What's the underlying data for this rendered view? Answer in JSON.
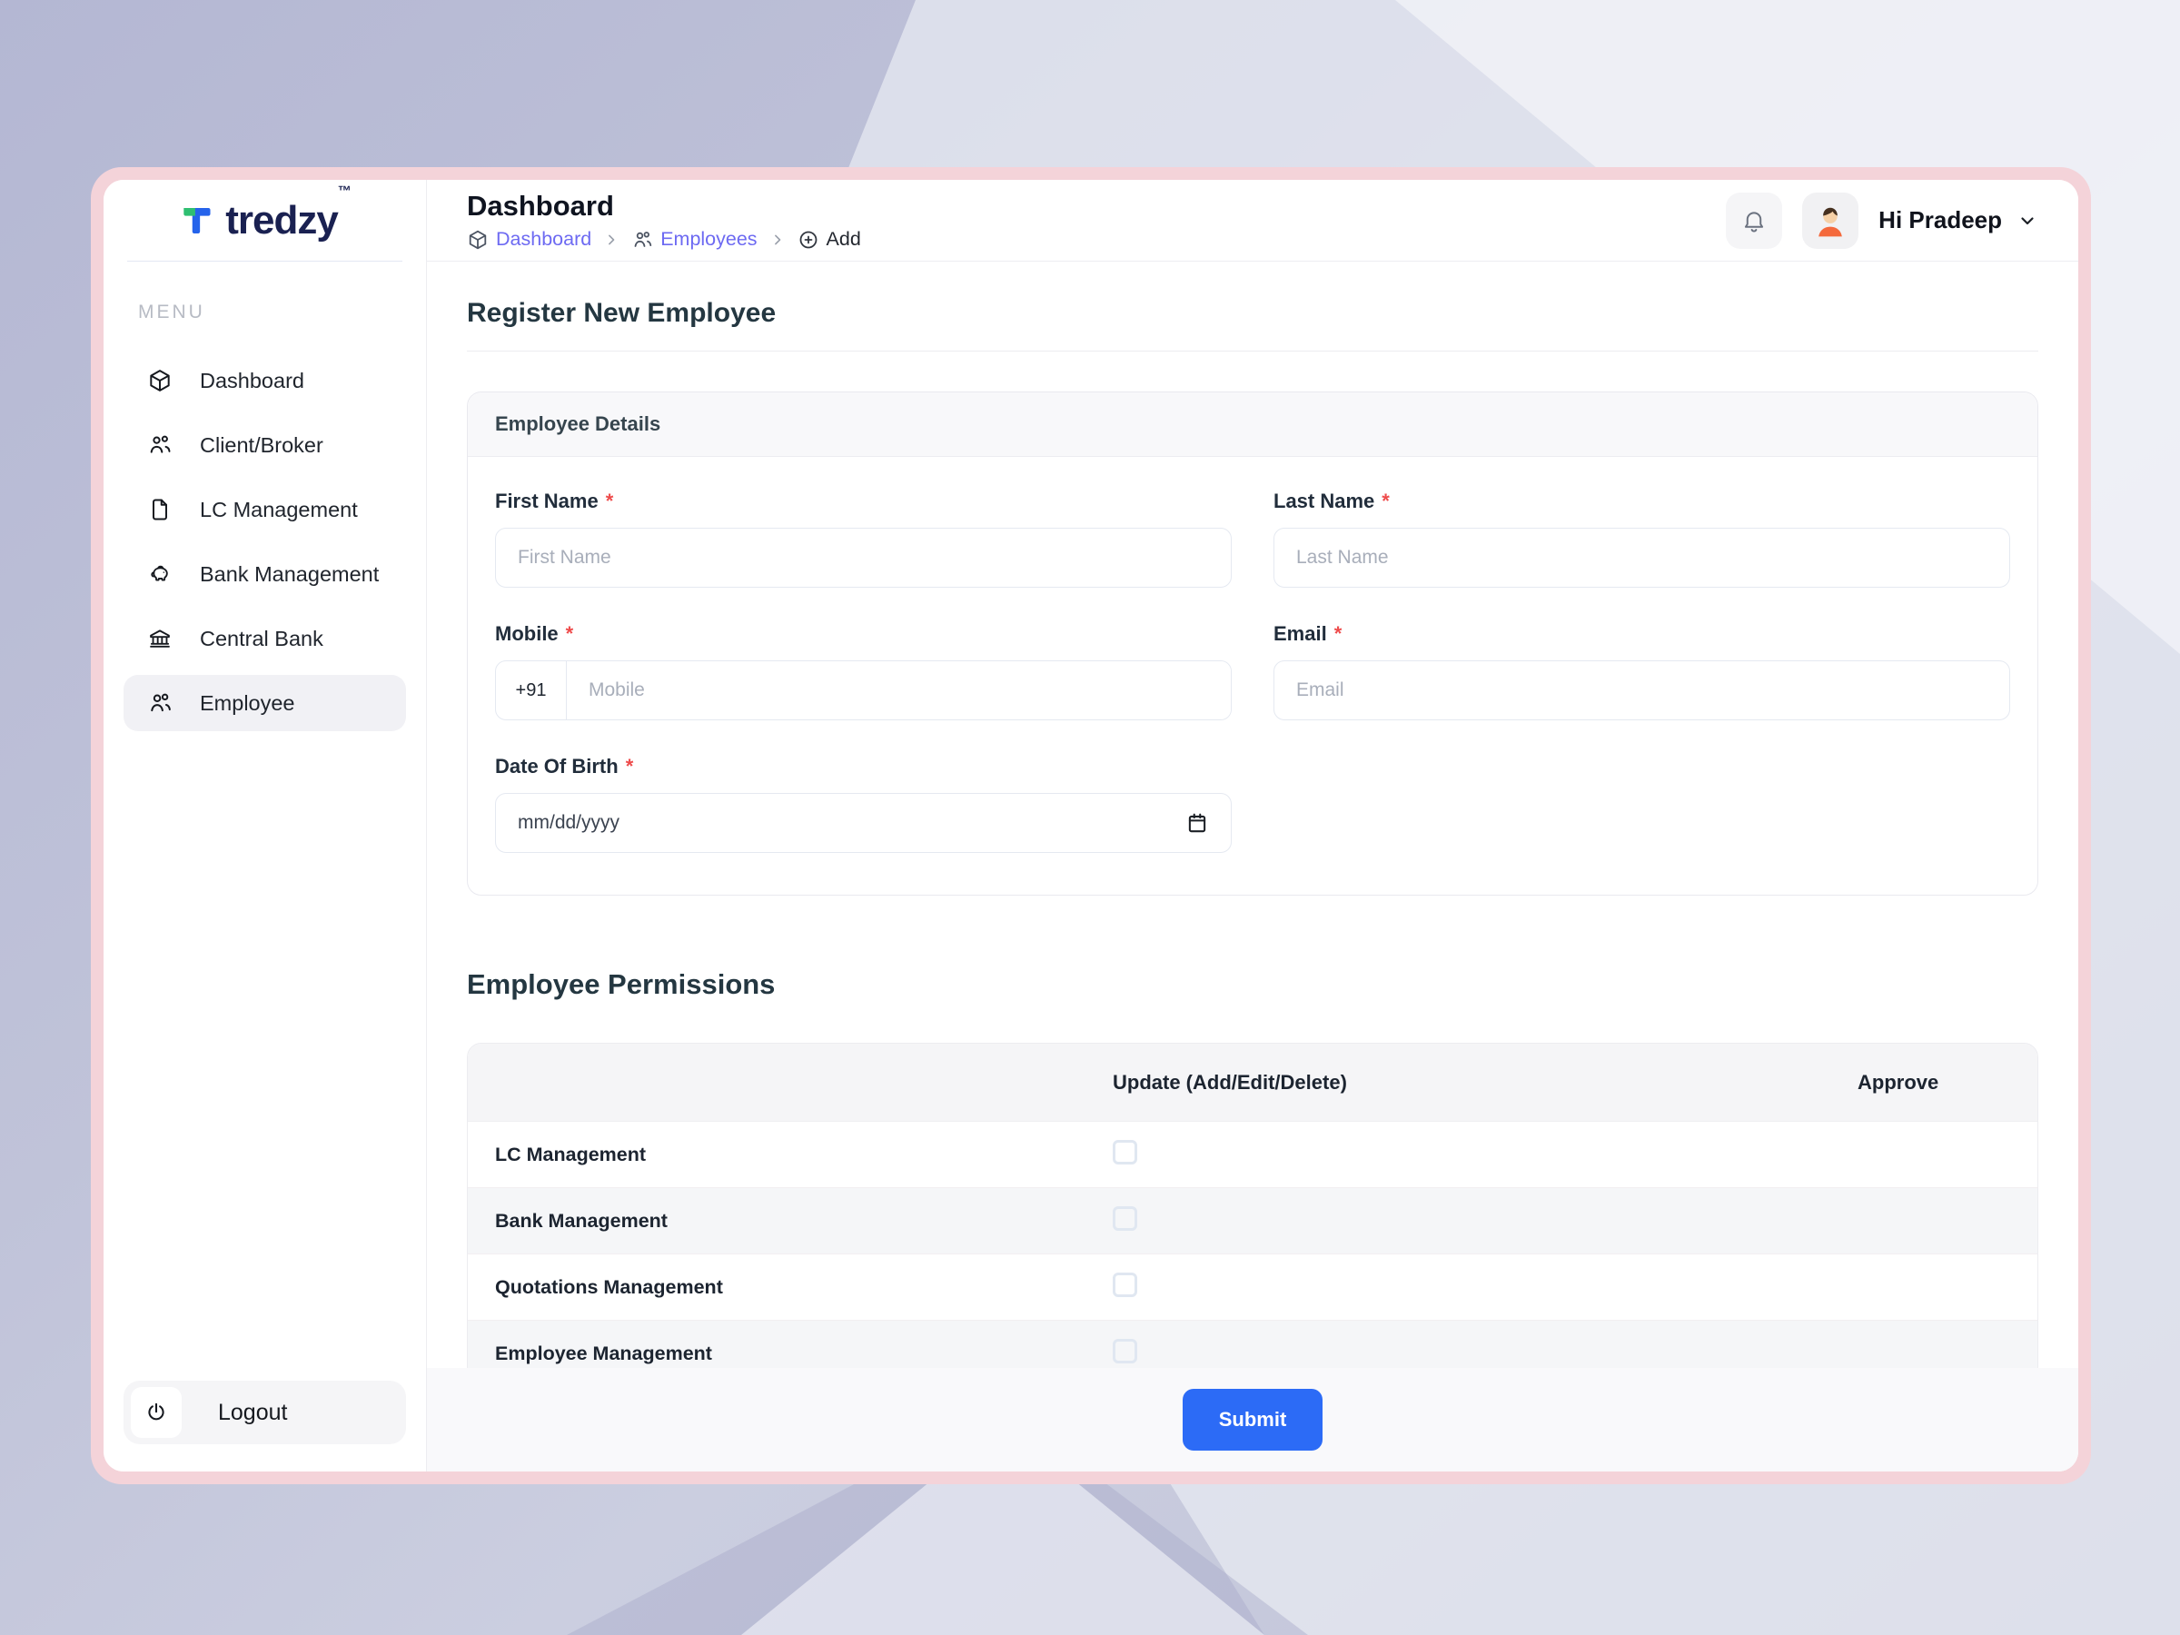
{
  "colors": {
    "accent_blue": "#2c6bf6",
    "link_purple": "#6d6af2",
    "required_red": "#ee4b4b",
    "window_ring_pink": "#f4d3d9",
    "brand_navy": "#1a2151",
    "brand_green": "#2fbf71",
    "brand_blue": "#2563eb"
  },
  "sidebar": {
    "logo": {
      "brand": "tredzy",
      "tm": "™",
      "mark_icon": "tredzy-t-logo"
    },
    "menu_label": "MENU",
    "items": [
      {
        "label": "Dashboard",
        "icon": "cube-icon",
        "active": false
      },
      {
        "label": "Client/Broker",
        "icon": "people-icon",
        "active": false
      },
      {
        "label": "LC Management",
        "icon": "document-icon",
        "active": false
      },
      {
        "label": "Bank Management",
        "icon": "piggy-bank-icon",
        "active": false
      },
      {
        "label": "Central Bank",
        "icon": "bank-icon",
        "active": false
      },
      {
        "label": "Employee",
        "icon": "users-icon",
        "active": true
      }
    ],
    "logout_label": "Logout",
    "logout_icon": "power-icon"
  },
  "header": {
    "title": "Dashboard",
    "breadcrumb": [
      {
        "label": "Dashboard",
        "icon": "cube-icon",
        "type": "link"
      },
      {
        "label": "Employees",
        "icon": "users-icon",
        "type": "link"
      },
      {
        "label": "Add",
        "icon": "plus-circle-icon",
        "type": "current"
      }
    ],
    "notifications_icon": "bell-icon",
    "user": {
      "greeting": "Hi Pradeep",
      "avatar_icon": "person-avatar",
      "menu_icon": "chevron-down-icon"
    }
  },
  "content": {
    "page_title": "Register New Employee",
    "required_marker": "*",
    "details_card": {
      "title": "Employee Details",
      "fields": [
        {
          "label": "First Name",
          "required": true,
          "placeholder": "First Name",
          "value": ""
        },
        {
          "label": "Last Name",
          "required": true,
          "placeholder": "Last Name",
          "value": ""
        },
        {
          "label": "Mobile",
          "required": true,
          "placeholder": "Mobile",
          "prefix": "+91",
          "value": ""
        },
        {
          "label": "Email",
          "required": true,
          "placeholder": "Email",
          "value": ""
        },
        {
          "label": "Date Of Birth",
          "required": true,
          "placeholder": "mm/dd/yyyy",
          "value": "",
          "icon": "calendar-icon"
        }
      ]
    },
    "permissions": {
      "title": "Employee Permissions",
      "columns": {
        "update": "Update (Add/Edit/Delete)",
        "approve": "Approve"
      },
      "rows": [
        {
          "label": "LC Management",
          "update_checked": false
        },
        {
          "label": "Bank Management",
          "update_checked": false
        },
        {
          "label": "Quotations Management",
          "update_checked": false
        },
        {
          "label": "Employee Management",
          "update_checked": false
        }
      ]
    },
    "submit_label": "Submit"
  }
}
